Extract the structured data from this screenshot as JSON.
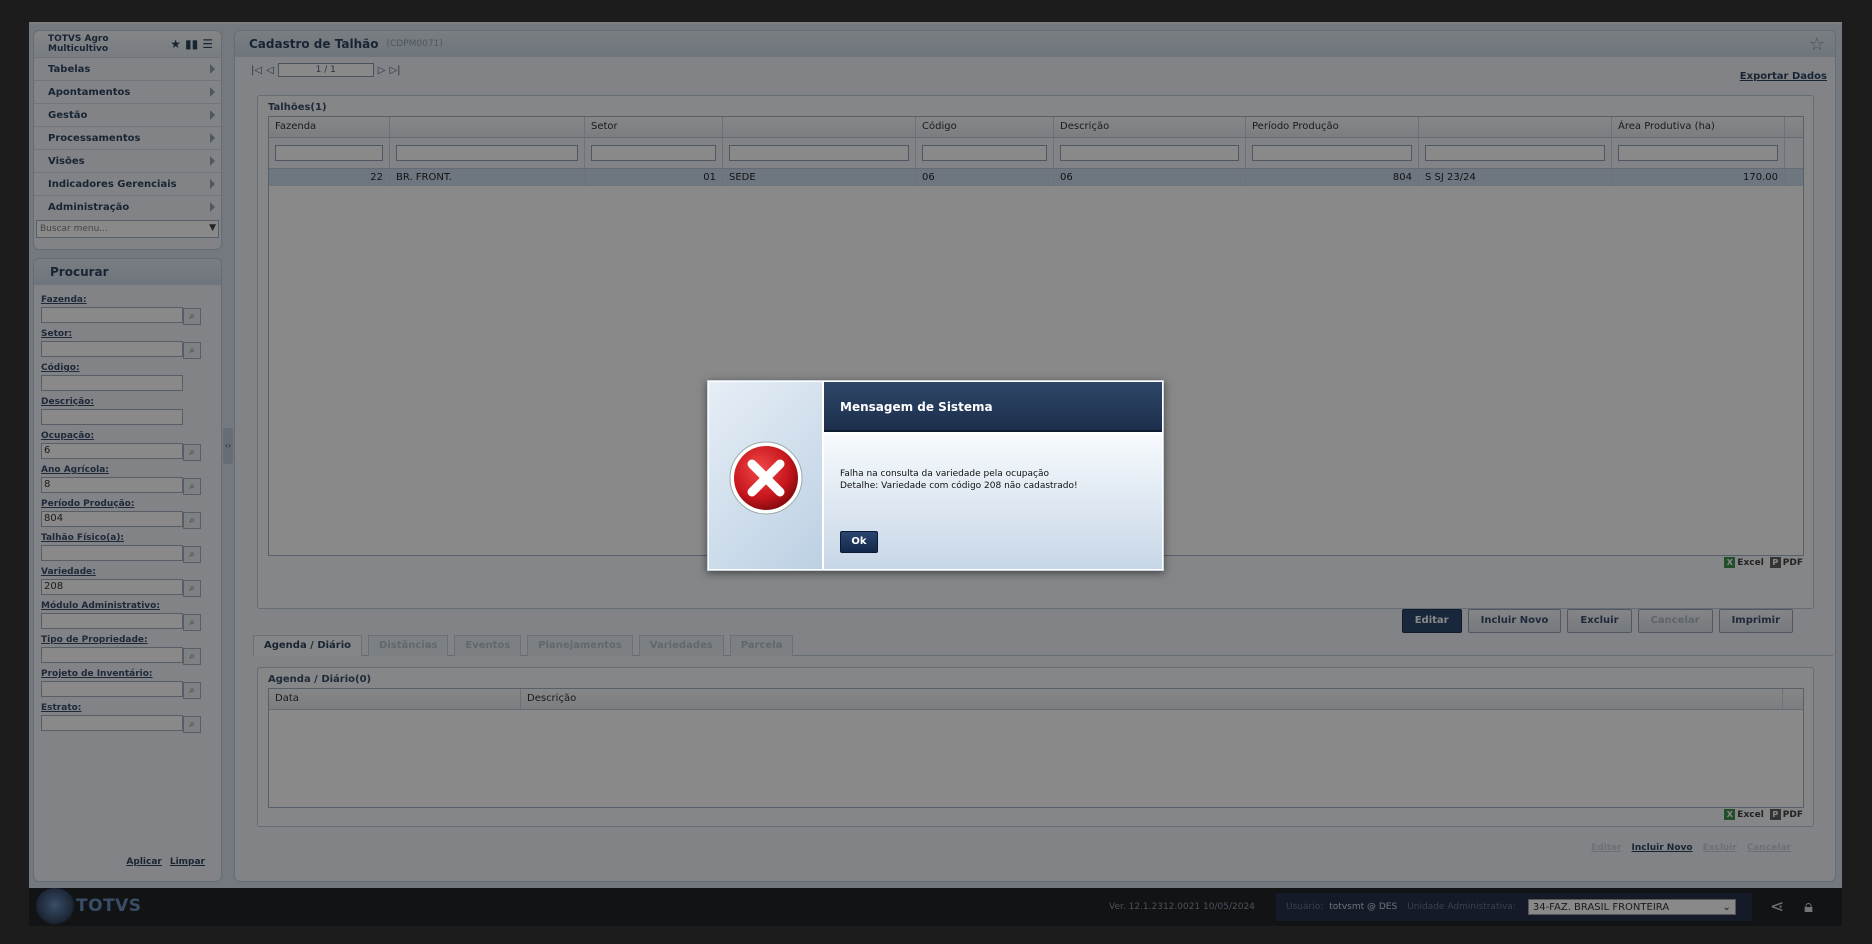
{
  "menu": {
    "title": "TOTVS Agro Multicultivo",
    "items": [
      {
        "label": "Tabelas"
      },
      {
        "label": "Apontamentos"
      },
      {
        "label": "Gestão"
      },
      {
        "label": "Processamentos"
      },
      {
        "label": "Visões"
      },
      {
        "label": "Indicadores Gerenciais"
      },
      {
        "label": "Administração"
      }
    ],
    "search_placeholder": "Buscar menu..."
  },
  "search": {
    "title": "Procurar",
    "fields": [
      {
        "label": "Fazenda:",
        "value": ""
      },
      {
        "label": "Setor:",
        "value": ""
      },
      {
        "label": "Código:",
        "value": ""
      },
      {
        "label": "Descrição:",
        "value": ""
      },
      {
        "label": "Ocupação:",
        "value": "6"
      },
      {
        "label": "Ano Agrícola:",
        "value": "8"
      },
      {
        "label": "Período Produção:",
        "value": "804"
      },
      {
        "label": "Talhão Físico(a):",
        "value": ""
      },
      {
        "label": "Variedade:",
        "value": "208"
      },
      {
        "label": "Módulo Administrativo:",
        "value": ""
      },
      {
        "label": "Tipo de Propriedade:",
        "value": ""
      },
      {
        "label": "Projeto de Inventário:",
        "value": ""
      },
      {
        "label": "Estrato:",
        "value": ""
      }
    ],
    "apply_label": "Aplicar",
    "clear_label": "Limpar"
  },
  "main": {
    "title": "Cadastro de Talhão",
    "code": "(CDPM0071)",
    "pager": "1 / 1",
    "export_label": "Exportar Dados",
    "grid_title": "Talhões(1)",
    "columns": [
      "Fazenda",
      "",
      "Setor",
      "",
      "Código",
      "Descrição",
      "Período Produção",
      "",
      "Área Produtiva (ha)"
    ],
    "rows": [
      [
        "22",
        "BR. FRONT.",
        "01",
        "SEDE",
        "06",
        "06",
        "804",
        "S SJ 23/24",
        "170.00"
      ]
    ],
    "excel_label": "Excel",
    "pdf_label": "PDF",
    "buttons": {
      "edit": "Editar",
      "new": "Incluir Novo",
      "delete": "Excluir",
      "cancel": "Cancelar",
      "print": "Imprimir"
    },
    "tabs": [
      "Agenda / Diário",
      "Distâncias",
      "Eventos",
      "Planejamentos",
      "Variedades",
      "Parcela"
    ],
    "agenda_title": "Agenda / Diário(0)",
    "agenda_columns": [
      "Data",
      "Descrição"
    ],
    "bottom_links": {
      "edit": "Editar",
      "new": "Incluir Novo",
      "delete": "Excluir",
      "cancel": "Cancelar"
    }
  },
  "footer": {
    "brand": "TOTVS",
    "version": "Ver. 12.1.2312.0021 10/05/2024",
    "user_label": "Usuário:",
    "user_value": "totvsmt @ DES",
    "unit_label": "Unidade Administrativa:",
    "unit_value": "34-FAZ. BRASIL FRONTEIRA"
  },
  "dialog": {
    "title": "Mensagem de Sistema",
    "line1": "Falha na consulta da variedade pela ocupação",
    "line2": "Detalhe: Variedade com código 208 não cadastrado!",
    "ok_label": "Ok"
  },
  "colors": {
    "header_navy": "#1d3a63",
    "error_red": "#c8161d",
    "panel_bg": "#eef3f8"
  }
}
